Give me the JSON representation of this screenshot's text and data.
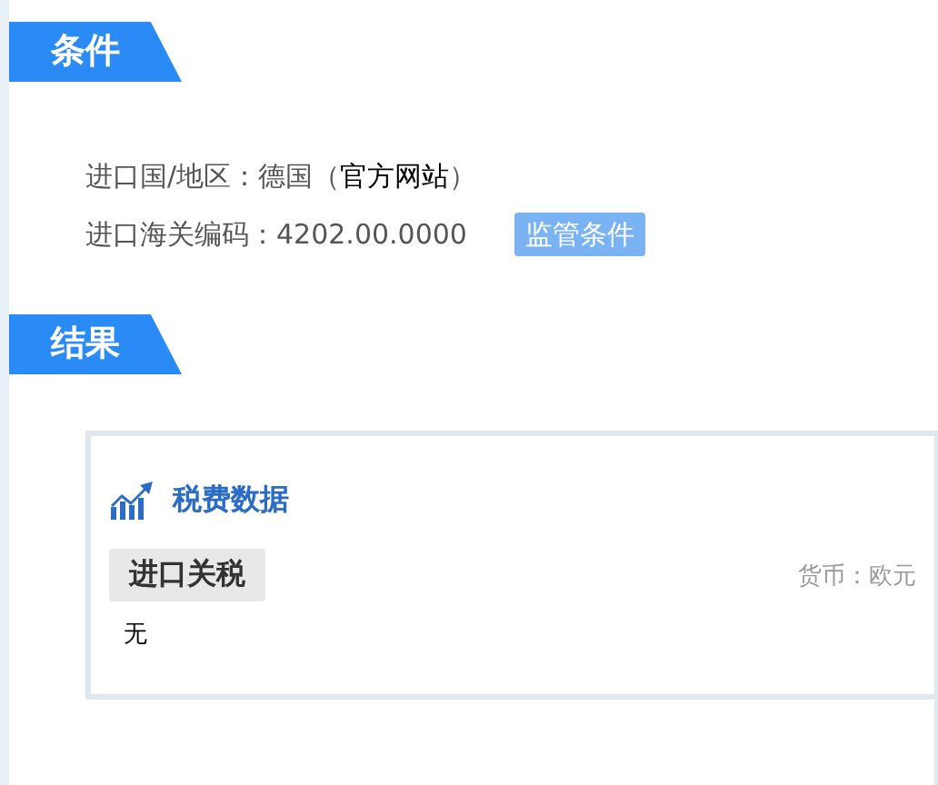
{
  "conditions": {
    "title": "条件",
    "country": {
      "label": "进口国/地区：德国（",
      "link": "官方网站",
      "close": "）"
    },
    "hs_code": {
      "text": "进口海关编码：4202.00.0000",
      "button": "监管条件"
    }
  },
  "results": {
    "title": "结果",
    "card": {
      "title": "税费数据",
      "tab": "进口关税",
      "currency": "货币：欧元",
      "value": "无"
    }
  }
}
